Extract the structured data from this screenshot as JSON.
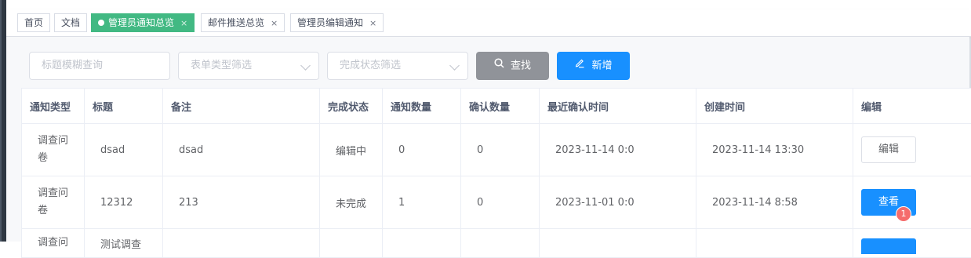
{
  "tags": [
    {
      "label": "首页",
      "active": false,
      "closable": false
    },
    {
      "label": "文档",
      "active": false,
      "closable": false
    },
    {
      "label": "管理员通知总览",
      "active": true,
      "closable": true
    },
    {
      "label": "邮件推送总览",
      "active": false,
      "closable": true
    },
    {
      "label": "管理员编辑通知",
      "active": false,
      "closable": true
    }
  ],
  "tag_close_symbol": "×",
  "filters": {
    "title_placeholder": "标题模糊查询",
    "form_type_placeholder": "表单类型筛选",
    "status_placeholder": "完成状态筛选",
    "search_label": "查找",
    "add_label": "新增"
  },
  "table": {
    "columns": [
      "通知类型",
      "标题",
      "备注",
      "完成状态",
      "通知数量",
      "确认数量",
      "最近确认时间",
      "创建时间",
      "编辑"
    ],
    "rows": [
      {
        "type": "调查问卷",
        "title": "dsad",
        "remark": "dsad",
        "status": "编辑中",
        "notify_count": "0",
        "confirm_count": "0",
        "last_confirm": "2023-11-14 0:0",
        "created": "2023-11-14 13:30",
        "action": "编辑"
      },
      {
        "type": "调查问卷",
        "title": "12312",
        "remark": "213",
        "status": "未完成",
        "notify_count": "1",
        "confirm_count": "0",
        "last_confirm": "2023-11-01 0:0",
        "created": "2023-11-14 8:58",
        "action": "查看",
        "badge": "1"
      },
      {
        "type": "调查问",
        "title": "测试调查",
        "remark": "",
        "status": "",
        "notify_count": "",
        "confirm_count": "",
        "last_confirm": "",
        "created": "",
        "action": ""
      }
    ]
  },
  "colors": {
    "active_tag": "#42b983",
    "primary": "#1890ff",
    "info": "#909399",
    "badge": "#f56c6c"
  }
}
